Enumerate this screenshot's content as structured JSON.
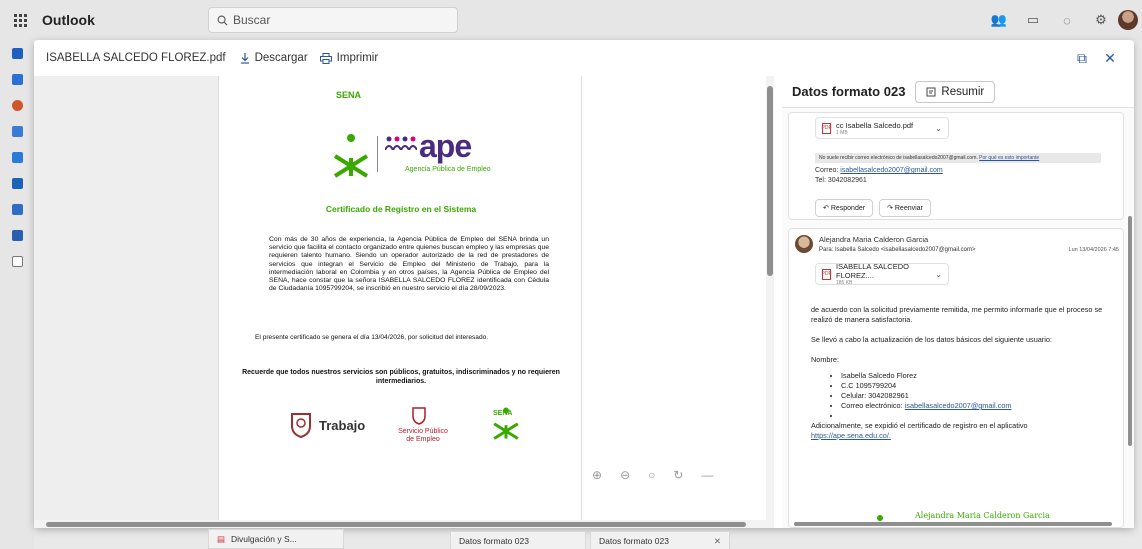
{
  "app": {
    "title": "Outlook"
  },
  "search": {
    "placeholder": "Buscar"
  },
  "viewer": {
    "filename": "ISABELLA SALCEDO FLOREZ.pdf",
    "download_label": "Descargar",
    "print_label": "Imprimir"
  },
  "pdf": {
    "sena": "SENA",
    "ape": "ape",
    "ape_sub": "Agencia Pública de Empleo",
    "title": "Certificado de Registro en el Sistema",
    "body": "Con más de 30 años de experiencia, la Agencia Pública de Empleo del SENA brinda un servicio que facilita el contacto organizado entre quienes buscan empleo y las empresas que requieren talento humano. Siendo un operador autorizado de la red de prestadores de servicios que integran el Servicio de Empleo del Ministerio de Trabajo, para la intermediación laboral en Colombia y en otros países, la Agencia Pública de Empleo del SENA, hace constar que la señora ISABELLA SALCEDO FLOREZ identificada con Cédula de Ciudadanía 1095799204, se inscribió en nuestro servicio el día 28/09/2023.",
    "generated": "El presente certificado se genera el día 13/04/2026, por solicitud del interesado.",
    "note": "Recuerde que todos nuestros servicios son públicos, gratuitos, indiscriminados y no requieren intermediarios.",
    "trabajo": "Trabajo",
    "spe": "Servicio Público de Empleo",
    "sena_footer": "SENA"
  },
  "mail": {
    "title": "Datos formato 023",
    "summarize_label": "Resumir",
    "msg1": {
      "attachment_name": "cc Isabella Salcedo.pdf",
      "attachment_size": "1 MB",
      "warning": "No suele recibir correo electrónico de isabellasalcedo2007@gmail.com.",
      "warning_link": "Por qué es esto importante",
      "email_label": "Correo: ",
      "email": "isabellasalcedo2007@gmail.com",
      "phone": "Tel: 3042082961",
      "reply": "Responder",
      "forward": "Reenviar"
    },
    "msg2": {
      "sender": "Alejandra Maria Calderon Garcia",
      "to": "Para:  Isabella Salcedo <isabellasalcedo2007@gmail.com>",
      "date": "Lun 13/04/2026 7:45",
      "attachment_name": "ISABELLA SALCEDO FLOREZ....",
      "attachment_size": "185 KB",
      "p1": "de acuerdo con la solicitud previamente remitida, me permito informarle que el proceso se realizó de manera satisfactoria.",
      "p2": "Se llevó a cabo la actualización de los datos básicos del siguiente usuario:",
      "name_label": "Nombre:",
      "items": [
        "Isabella Salcedo Florez",
        "C.C 1095799204",
        "Celular: 3042082961"
      ],
      "email_item_label": "Correo electrónico: ",
      "email_item": "isabellasalcedo2007@gmail.com",
      "p3": "Adicionalmente, se expidió el certificado de registro en el aplicativo",
      "link": "https://ape.sena.edu.co/.",
      "signature": "Alejandra Maria Calderon Garcia"
    }
  },
  "taskbar": {
    "tab1": "Divulgación y S...",
    "tab2": "Datos formato 023",
    "tab3": "Datos formato 023"
  },
  "colors": {
    "accent": "#2b579a",
    "sena_green": "#39a900",
    "ape_purple": "#4a2b82"
  }
}
